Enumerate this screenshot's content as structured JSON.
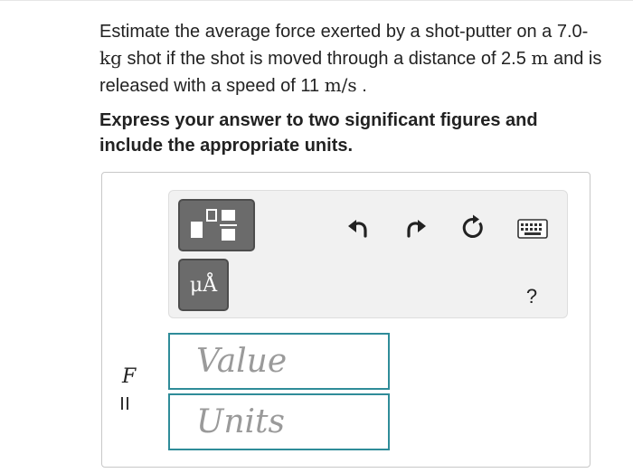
{
  "question": {
    "part1": "Estimate the average force exerted by a shot-putter on a 7.0-",
    "unit_kg": "kg",
    "part2": " shot if the shot is moved through a distance of 2.5 ",
    "unit_m": "m",
    "part3": " and is released with a speed of 11 ",
    "unit_speed": "m/s",
    "part4": " ."
  },
  "instruction": "Express your answer to two significant figures and include the appropriate units.",
  "toolbar": {
    "units_button_label": "μÅ",
    "help_label": "?",
    "icons": [
      "templates-icon",
      "units-icon",
      "undo-icon",
      "redo-icon",
      "reset-icon",
      "keyboard-icon",
      "help-icon"
    ]
  },
  "answer": {
    "variable": "F",
    "equals": "=",
    "value_placeholder": "Value",
    "units_placeholder": "Units"
  },
  "colors": {
    "field_border": "#2f8c99",
    "tool_button": "#6b6b6b",
    "toolbar_bg": "#f1f1f1"
  }
}
